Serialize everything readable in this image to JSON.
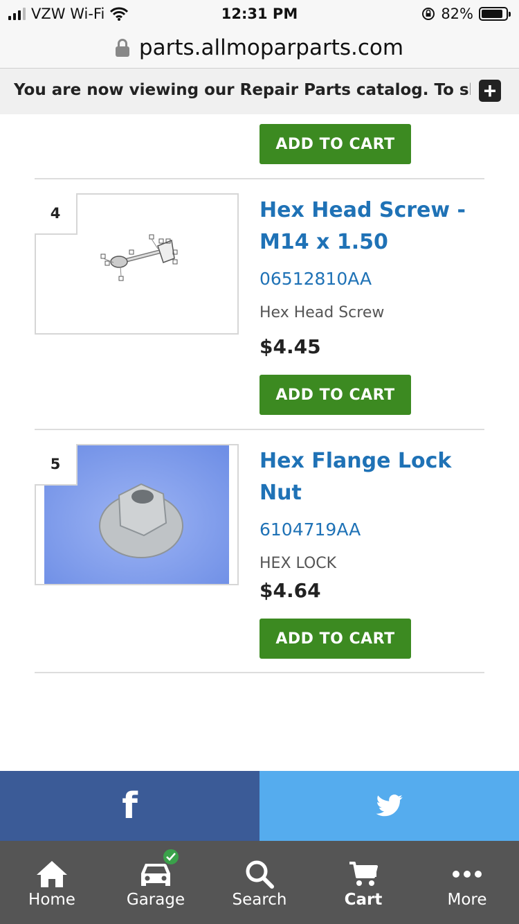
{
  "status_bar": {
    "carrier": "VZW Wi-Fi",
    "time": "12:31 PM",
    "battery": "82%",
    "battery_level": 0.82
  },
  "browser": {
    "url": "parts.allmoparparts.com"
  },
  "notice": {
    "text": "You are now viewing our Repair Parts catalog. To sho"
  },
  "add_to_cart_label": "ADD TO CART",
  "products": [
    {
      "index": "4",
      "title": "Hex Head Screw - M14 x 1.50",
      "part_number": "06512810AA",
      "description": "Hex Head Screw",
      "price": "$4.45"
    },
    {
      "index": "5",
      "title": "Hex Flange Lock Nut",
      "part_number": "6104719AA",
      "description": "HEX LOCK",
      "price": "$4.64"
    }
  ],
  "social": {
    "facebook": "f"
  },
  "tabbar": {
    "items": [
      {
        "label": "Home",
        "icon": "home-icon"
      },
      {
        "label": "Garage",
        "icon": "car-icon"
      },
      {
        "label": "Search",
        "icon": "search-icon"
      },
      {
        "label": "Cart",
        "icon": "cart-icon"
      },
      {
        "label": "More",
        "icon": "more-icon"
      }
    ]
  },
  "colors": {
    "accent_green": "#3c8a21",
    "link_blue": "#1f72b6",
    "facebook": "#3b5b97",
    "twitter": "#55acee",
    "tabbar": "#555555"
  }
}
